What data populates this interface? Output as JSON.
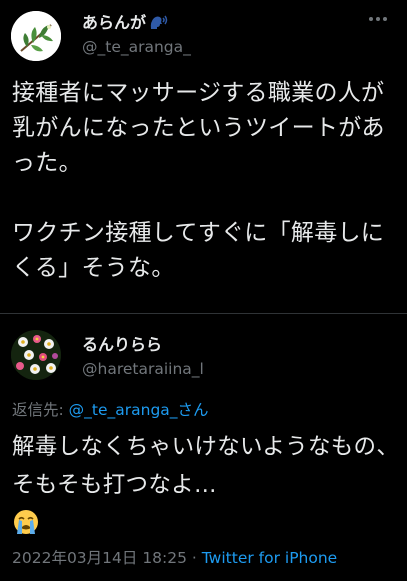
{
  "tweet": {
    "author_name": "あらんが",
    "author_handle": "@_te_aranga_",
    "name_emoji_icon": "speaking-head-icon",
    "text": "接種者にマッサージする職業の人が乳がんになったというツイートがあった。\n\nワクチン接種してすぐに「解毒しにくる」そうな。"
  },
  "reply": {
    "author_name": "るんりらら",
    "author_handle": "@haretaraiina_l",
    "replying_to_prefix": "返信先: ",
    "replying_to_handle": "@_te_aranga_さん",
    "text": "解毒しなくちゃいけないようなもの、そもそも打つなよ…",
    "emoji_icon": "loudly-crying-face-icon",
    "date": "2022年03月14日 18:25",
    "separator": " · ",
    "source": "Twitter for iPhone"
  },
  "colors": {
    "background": "#000000",
    "text": "#e7e9ea",
    "secondary": "#71767b",
    "link": "#1d9bf0",
    "divider": "#2f3336"
  }
}
